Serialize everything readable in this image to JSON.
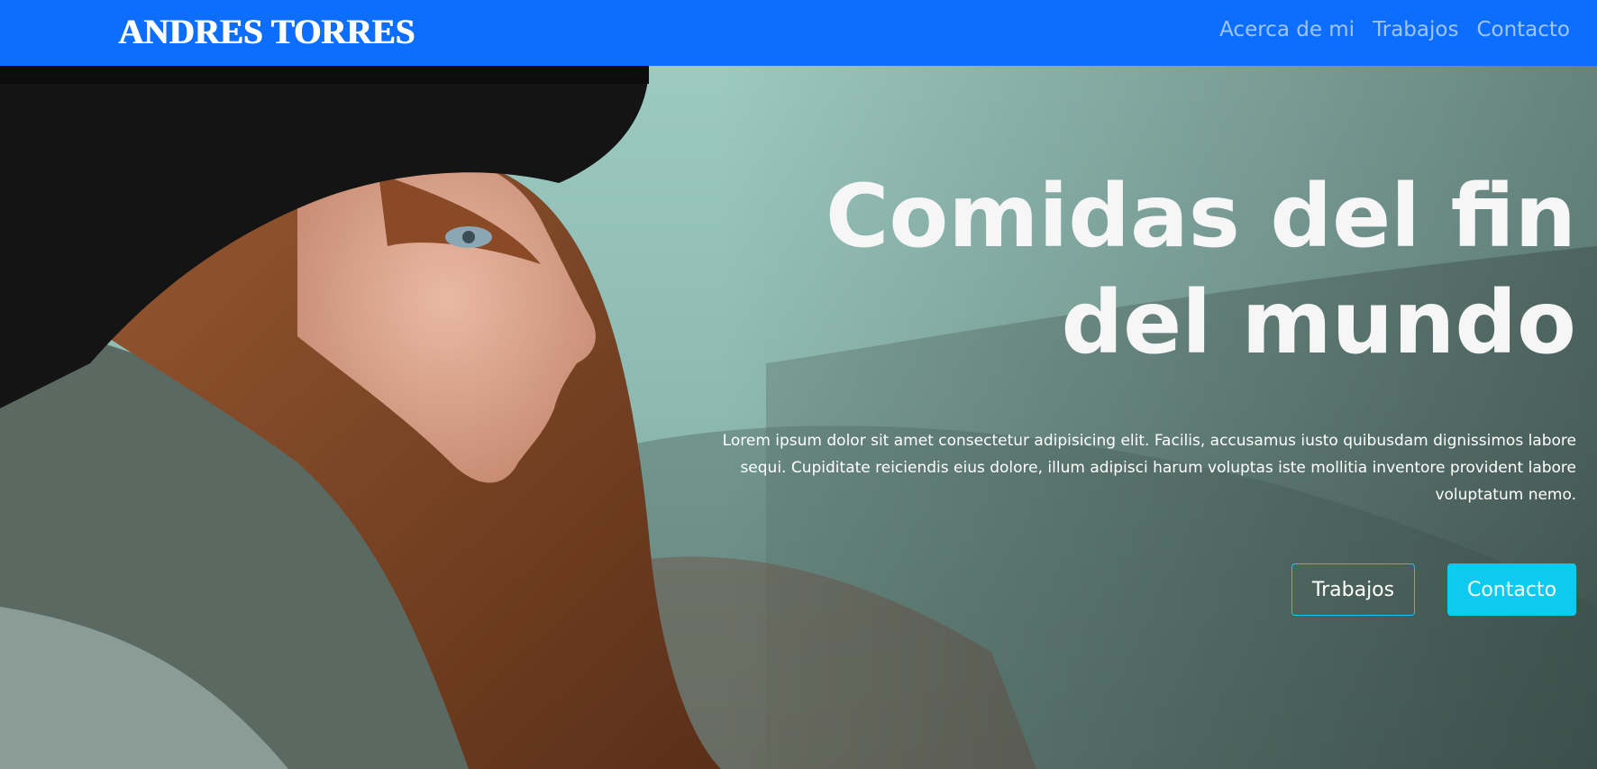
{
  "navbar": {
    "brand": "ANDRES TORRES",
    "links": [
      {
        "label": "Acerca de mi"
      },
      {
        "label": "Trabajos"
      },
      {
        "label": "Contacto"
      }
    ],
    "background_color": "#0d6efd"
  },
  "hero": {
    "title": "Comidas del fin del mundo",
    "description": "Lorem ipsum dolor sit amet consectetur adipisicing elit. Facilis, accusamus iusto quibusdam dignissimos labore sequi. Cupiditate reiciendis eius dolore, illum adipisci harum voluptas iste mollitia inventore provident labore voluptatum nemo.",
    "buttons": {
      "secondary_label": "Trabajos",
      "primary_label": "Contacto"
    },
    "accent_color": "#0dcaf0"
  }
}
